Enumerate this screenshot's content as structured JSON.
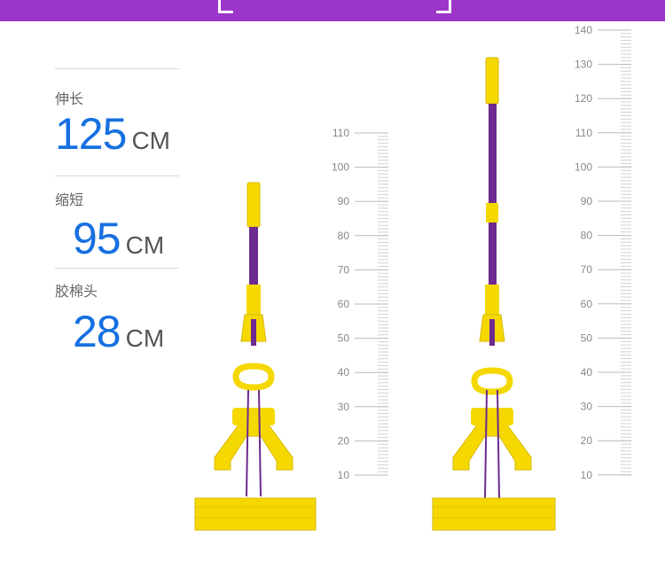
{
  "specs": [
    {
      "label": "伸长",
      "value": "125",
      "unit": "CM"
    },
    {
      "label": "缩短",
      "value": "95",
      "unit": "CM"
    },
    {
      "label": "胶棉头",
      "value": "28",
      "unit": "CM"
    }
  ],
  "ruler_short": {
    "labels": [
      "110",
      "100",
      "90",
      "80",
      "70",
      "60",
      "50",
      "40",
      "30",
      "20",
      "10"
    ]
  },
  "ruler_tall": {
    "labels": [
      "140",
      "130",
      "120",
      "110",
      "100",
      "90",
      "80",
      "70",
      "60",
      "50",
      "40",
      "30",
      "20",
      "10"
    ]
  },
  "colors": {
    "banner": "#9b36c9",
    "accent": "#1670e0",
    "mop_yellow": "#f5d800",
    "mop_purple": "#6d2a8f"
  }
}
